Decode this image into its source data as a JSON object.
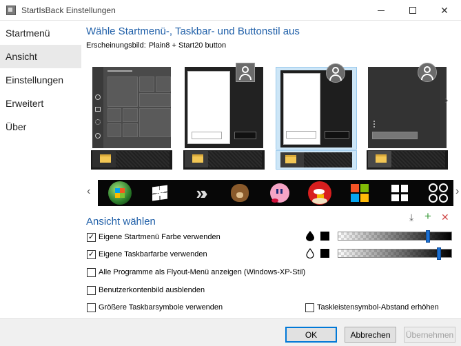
{
  "window": {
    "title": "StartIsBack Einstellungen"
  },
  "sidebar": {
    "items": [
      {
        "label": "Startmenü",
        "active": false
      },
      {
        "label": "Ansicht",
        "active": true
      },
      {
        "label": "Einstellungen",
        "active": false
      },
      {
        "label": "Erweitert",
        "active": false
      },
      {
        "label": "Über",
        "active": false
      }
    ]
  },
  "style": {
    "heading": "Wähle Startmenü-, Taskbar- und Buttonstil aus",
    "appearance_label": "Erscheinungsbild:",
    "appearance_value": "Plain8 + Start20 button"
  },
  "icons": {
    "prev_thumb": "chevron-left-icon",
    "next_thumb": "chevron-right-icon",
    "prev_button": "chevron-left-icon",
    "next_button": "chevron-right-icon",
    "download": "download-icon",
    "add": "plus-icon",
    "remove": "x-icon",
    "drop_filled": "drop-filled-icon",
    "drop_outline": "drop-outline-icon"
  },
  "start_buttons": [
    "windows-7-orb",
    "windows-logo-white",
    "chevrons",
    "bear",
    "kirby",
    "angry-bird",
    "windows-10-colored",
    "windows-8-tiles",
    "circles"
  ],
  "view": {
    "title": "Ansicht wählen",
    "options": [
      {
        "label": "Eigene Startmenü Farbe verwenden",
        "checked": true
      },
      {
        "label": "Eigene Taskbarfarbe verwenden",
        "checked": true
      },
      {
        "label": "Alle Programme als Flyout-Menü anzeigen (Windows-XP-Stil)",
        "checked": false
      },
      {
        "label": "Benutzerkontenbild ausblenden",
        "checked": false
      },
      {
        "label": "Größere Taskbarsymbole verwenden",
        "checked": false
      },
      {
        "label": "Taskleistensymbol-Abstand erhöhen",
        "checked": false
      }
    ],
    "menu_transparency": 0.8,
    "taskbar_transparency": 0.9,
    "accent": "#1b6fd1"
  },
  "footer": {
    "ok": "OK",
    "cancel": "Abbrechen",
    "apply": "Übernehmen"
  }
}
